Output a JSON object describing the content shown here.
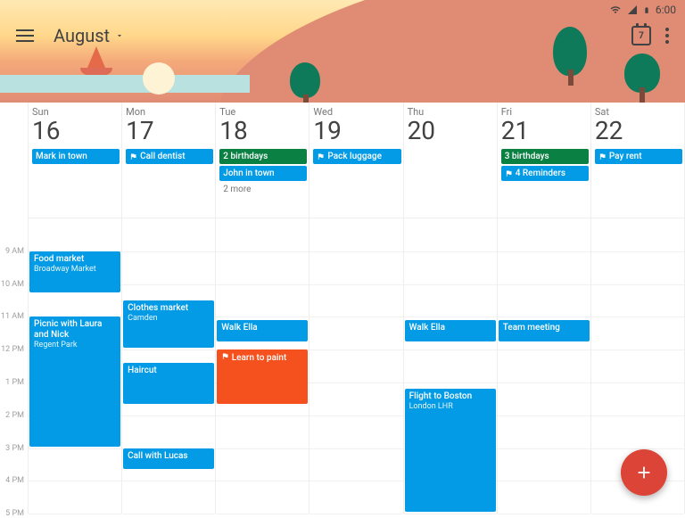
{
  "status": {
    "time": "6:00"
  },
  "header": {
    "month": "August",
    "today_badge": "7"
  },
  "time_labels": [
    "9 AM",
    "10 AM",
    "11 AM",
    "12 PM",
    "1 PM",
    "2 PM",
    "3 PM",
    "4 PM",
    "5 PM"
  ],
  "hour_start": 8,
  "row_h": 36.8,
  "days": [
    {
      "dow": "Sun",
      "num": "16",
      "allday": [
        {
          "label": "Mark in town",
          "color": "blue"
        }
      ],
      "events": [
        {
          "title": "Food market",
          "sub": "Broadway Market",
          "start": 9,
          "end": 10.3,
          "color": "blue"
        },
        {
          "title": "Picnic with Laura and Nick",
          "sub": "Regent Park",
          "start": 11,
          "end": 15,
          "color": "blue"
        }
      ]
    },
    {
      "dow": "Mon",
      "num": "17",
      "allday": [
        {
          "label": "Call dentist",
          "color": "blue",
          "icon": "flag"
        }
      ],
      "events": [
        {
          "title": "Clothes market",
          "sub": "Camden",
          "start": 10.5,
          "end": 12,
          "color": "blue"
        },
        {
          "title": "Haircut",
          "sub": "",
          "start": 12.4,
          "end": 13.7,
          "color": "blue"
        },
        {
          "title": "Call with Lucas",
          "sub": "",
          "start": 15,
          "end": 15.7,
          "color": "blue"
        }
      ]
    },
    {
      "dow": "Tue",
      "num": "18",
      "allday": [
        {
          "label": "2 birthdays",
          "color": "green"
        },
        {
          "label": "John in town",
          "color": "blue"
        }
      ],
      "more": "2 more",
      "events": [
        {
          "title": "Walk Ella",
          "sub": "",
          "start": 11.1,
          "end": 11.8,
          "color": "blue"
        },
        {
          "title": "Learn to paint",
          "sub": "",
          "start": 12,
          "end": 13.7,
          "color": "orange",
          "icon": "flag"
        }
      ]
    },
    {
      "dow": "Wed",
      "num": "19",
      "allday": [
        {
          "label": "Pack luggage",
          "color": "blue",
          "icon": "flag"
        }
      ],
      "events": []
    },
    {
      "dow": "Thu",
      "num": "20",
      "allday": [],
      "events": [
        {
          "title": "Walk Ella",
          "sub": "",
          "start": 11.1,
          "end": 11.8,
          "color": "blue"
        },
        {
          "title": "Flight to Boston",
          "sub": "London LHR",
          "start": 13.2,
          "end": 17,
          "color": "blue"
        }
      ]
    },
    {
      "dow": "Fri",
      "num": "21",
      "allday": [
        {
          "label": "3 birthdays",
          "color": "green"
        },
        {
          "label": "4 Reminders",
          "color": "blue",
          "icon": "flag"
        }
      ],
      "events": [
        {
          "title": "Team meeting",
          "sub": "",
          "start": 11.1,
          "end": 11.8,
          "color": "blue"
        }
      ]
    },
    {
      "dow": "Sat",
      "num": "22",
      "allday": [
        {
          "label": "Pay rent",
          "color": "blue",
          "icon": "flag"
        }
      ],
      "events": []
    }
  ]
}
